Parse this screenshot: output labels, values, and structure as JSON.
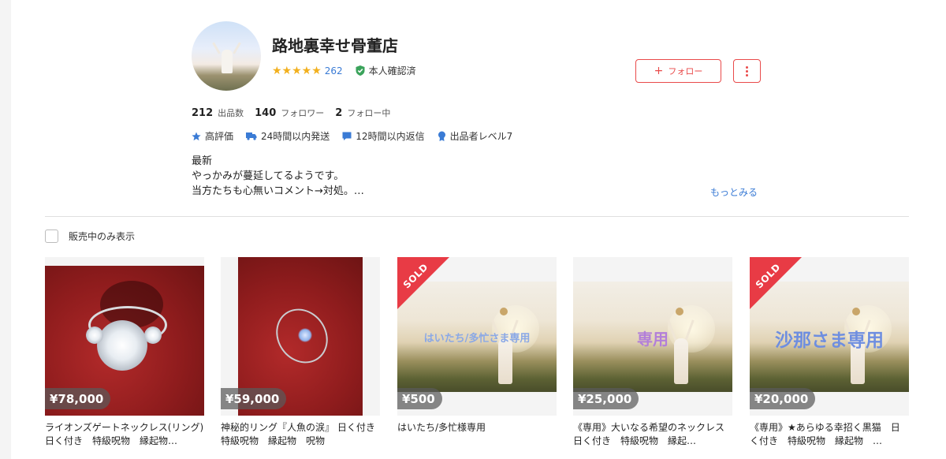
{
  "profile": {
    "name": "路地裏幸せ骨董店",
    "stars": "★★★★★",
    "rating_count": "262",
    "verified": "本人確認済",
    "follow_label": "フォロー",
    "follow_icon": "+"
  },
  "stats": [
    {
      "value": "212",
      "label": "出品数"
    },
    {
      "value": "140",
      "label": "フォロワー"
    },
    {
      "value": "2",
      "label": "フォロー中"
    }
  ],
  "badges": [
    {
      "icon": "star-icon",
      "label": "高評価"
    },
    {
      "icon": "truck-icon",
      "label": "24時間以内発送"
    },
    {
      "icon": "chat-icon",
      "label": "12時間以内返信"
    },
    {
      "icon": "medal-icon",
      "label": "出品者レベル7"
    }
  ],
  "bio": {
    "lines": [
      "最新",
      "やっかみが蔓延してるようです。",
      "当方たちも心無いコメント→対処。…"
    ],
    "more": "もっとみる"
  },
  "filter": {
    "label": "販売中のみ表示",
    "checked": false
  },
  "sold_label": "SOLD",
  "colors": {
    "accent": "#e94a4a",
    "link": "#3a7bd5",
    "star": "#f2b01e"
  },
  "items": [
    {
      "price": "¥78,000",
      "title": "ライオンズゲートネックレス(リング) 日く付き　特級呪物　縁起物…",
      "sold": false,
      "overlay": ""
    },
    {
      "price": "¥59,000",
      "title": "神秘的リング『人魚の涙』 日く付き　特級呪物　縁起物　呪物",
      "sold": false,
      "overlay": ""
    },
    {
      "price": "¥500",
      "title": "はいたち/多忙様専用",
      "sold": true,
      "overlay": "はいたち/多忙さま専用"
    },
    {
      "price": "¥25,000",
      "title": "《専用》大いなる希望のネックレス　日く付き　特級呪物　縁起…",
      "sold": false,
      "overlay": "専用"
    },
    {
      "price": "¥20,000",
      "title": "《専用》★あらゆる幸招く黒猫　日く付き　特級呪物　縁起物　…",
      "sold": true,
      "overlay": "沙那さま専用"
    }
  ]
}
